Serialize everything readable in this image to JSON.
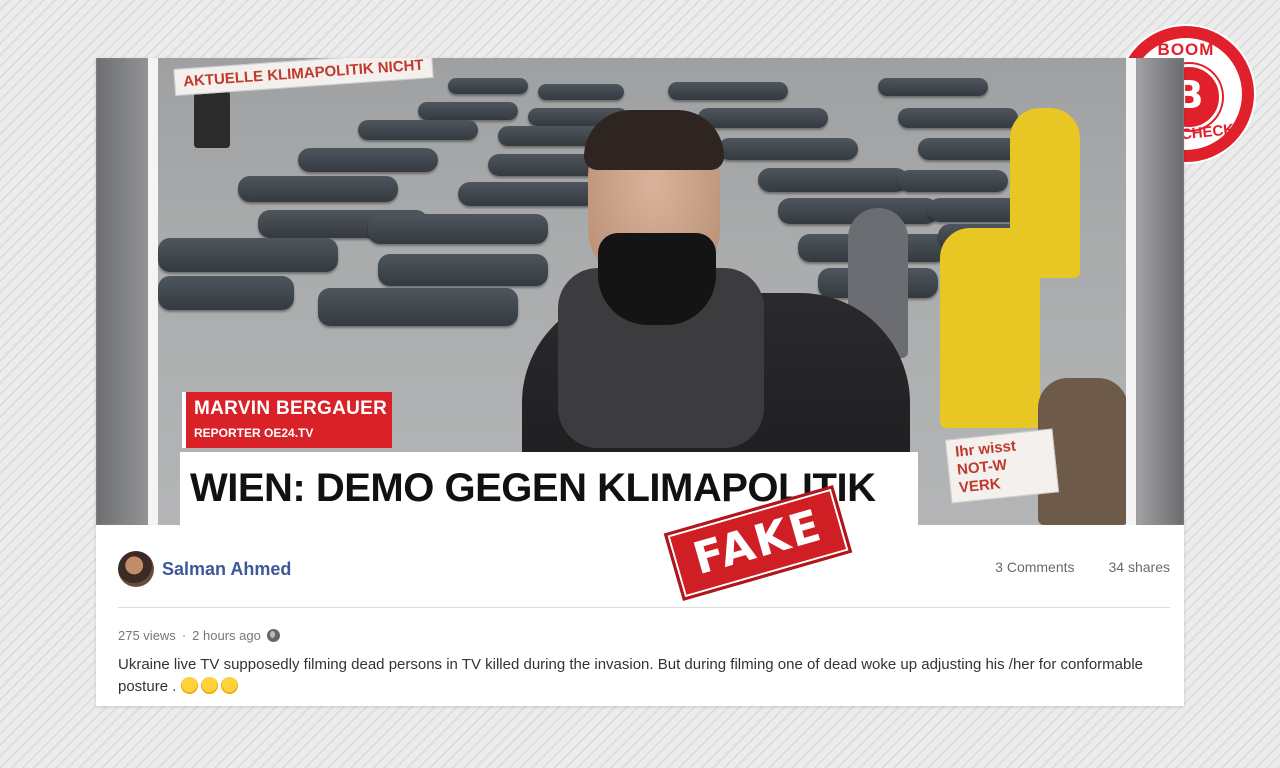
{
  "video": {
    "reporter_name": "MARVIN BERGAUER",
    "reporter_role": "REPORTER OE24.TV",
    "headline": "WIEN: DEMO GEGEN KLIMAPOLITIK",
    "sign_top": "AKTUELLE KLIMAPOLITIK NICHT",
    "sign_bottom": "Ihr wisst NOT-W VERK",
    "stamp": "FAKE"
  },
  "logo": {
    "top": "BOOM",
    "letter": "B",
    "bottom": "FACT CHECK",
    "color": "#e0202b"
  },
  "post": {
    "author": "Salman Ahmed",
    "comments": "3 Comments",
    "shares": "34 shares",
    "views": "275 views",
    "time": "2 hours ago",
    "text": "Ukraine live TV supposedly filming dead persons in TV killed during the invasion. But during filming one of dead woke up adjusting his /her for conformable posture .",
    "author_color": "#3b5998"
  }
}
